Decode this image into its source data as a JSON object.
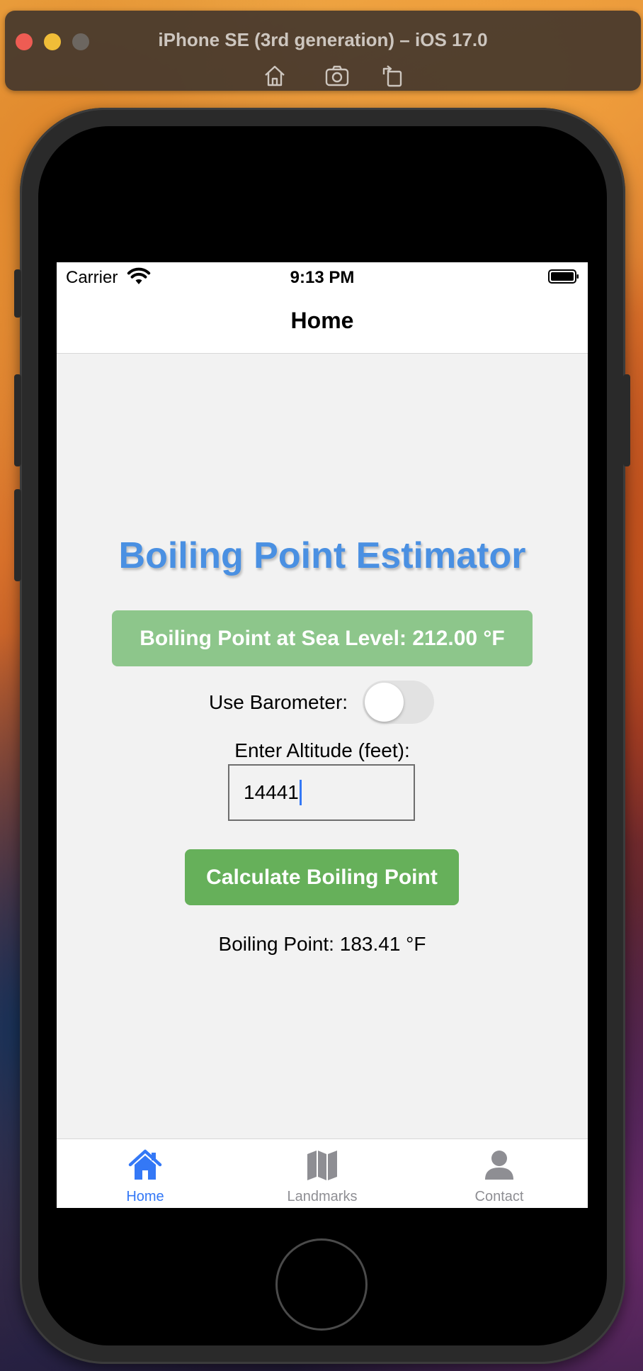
{
  "simulator": {
    "title": "iPhone SE (3rd generation) – iOS 17.0",
    "toolbar_icons": [
      "home-icon",
      "screenshot-icon",
      "rotate-icon"
    ]
  },
  "status_bar": {
    "carrier": "Carrier",
    "time": "9:13 PM"
  },
  "nav": {
    "title": "Home"
  },
  "main": {
    "app_title": "Boiling Point Estimator",
    "sea_level_banner": "Boiling Point at Sea Level: 212.00 °F",
    "barometer_label": "Use Barometer:",
    "barometer_on": false,
    "altitude_label": "Enter Altitude (feet):",
    "altitude_value": "14441",
    "calculate_button": "Calculate Boiling Point",
    "result": "Boiling Point: 183.41 °F"
  },
  "tabs": [
    {
      "label": "Home",
      "icon": "house-icon",
      "active": true
    },
    {
      "label": "Landmarks",
      "icon": "map-icon",
      "active": false
    },
    {
      "label": "Contact",
      "icon": "person-icon",
      "active": false
    }
  ],
  "colors": {
    "accent_blue": "#3478f6",
    "title_blue": "#4a90e2",
    "banner_green": "#8dc68b",
    "button_green": "#66b05a",
    "inactive_gray": "#8e8e93"
  }
}
